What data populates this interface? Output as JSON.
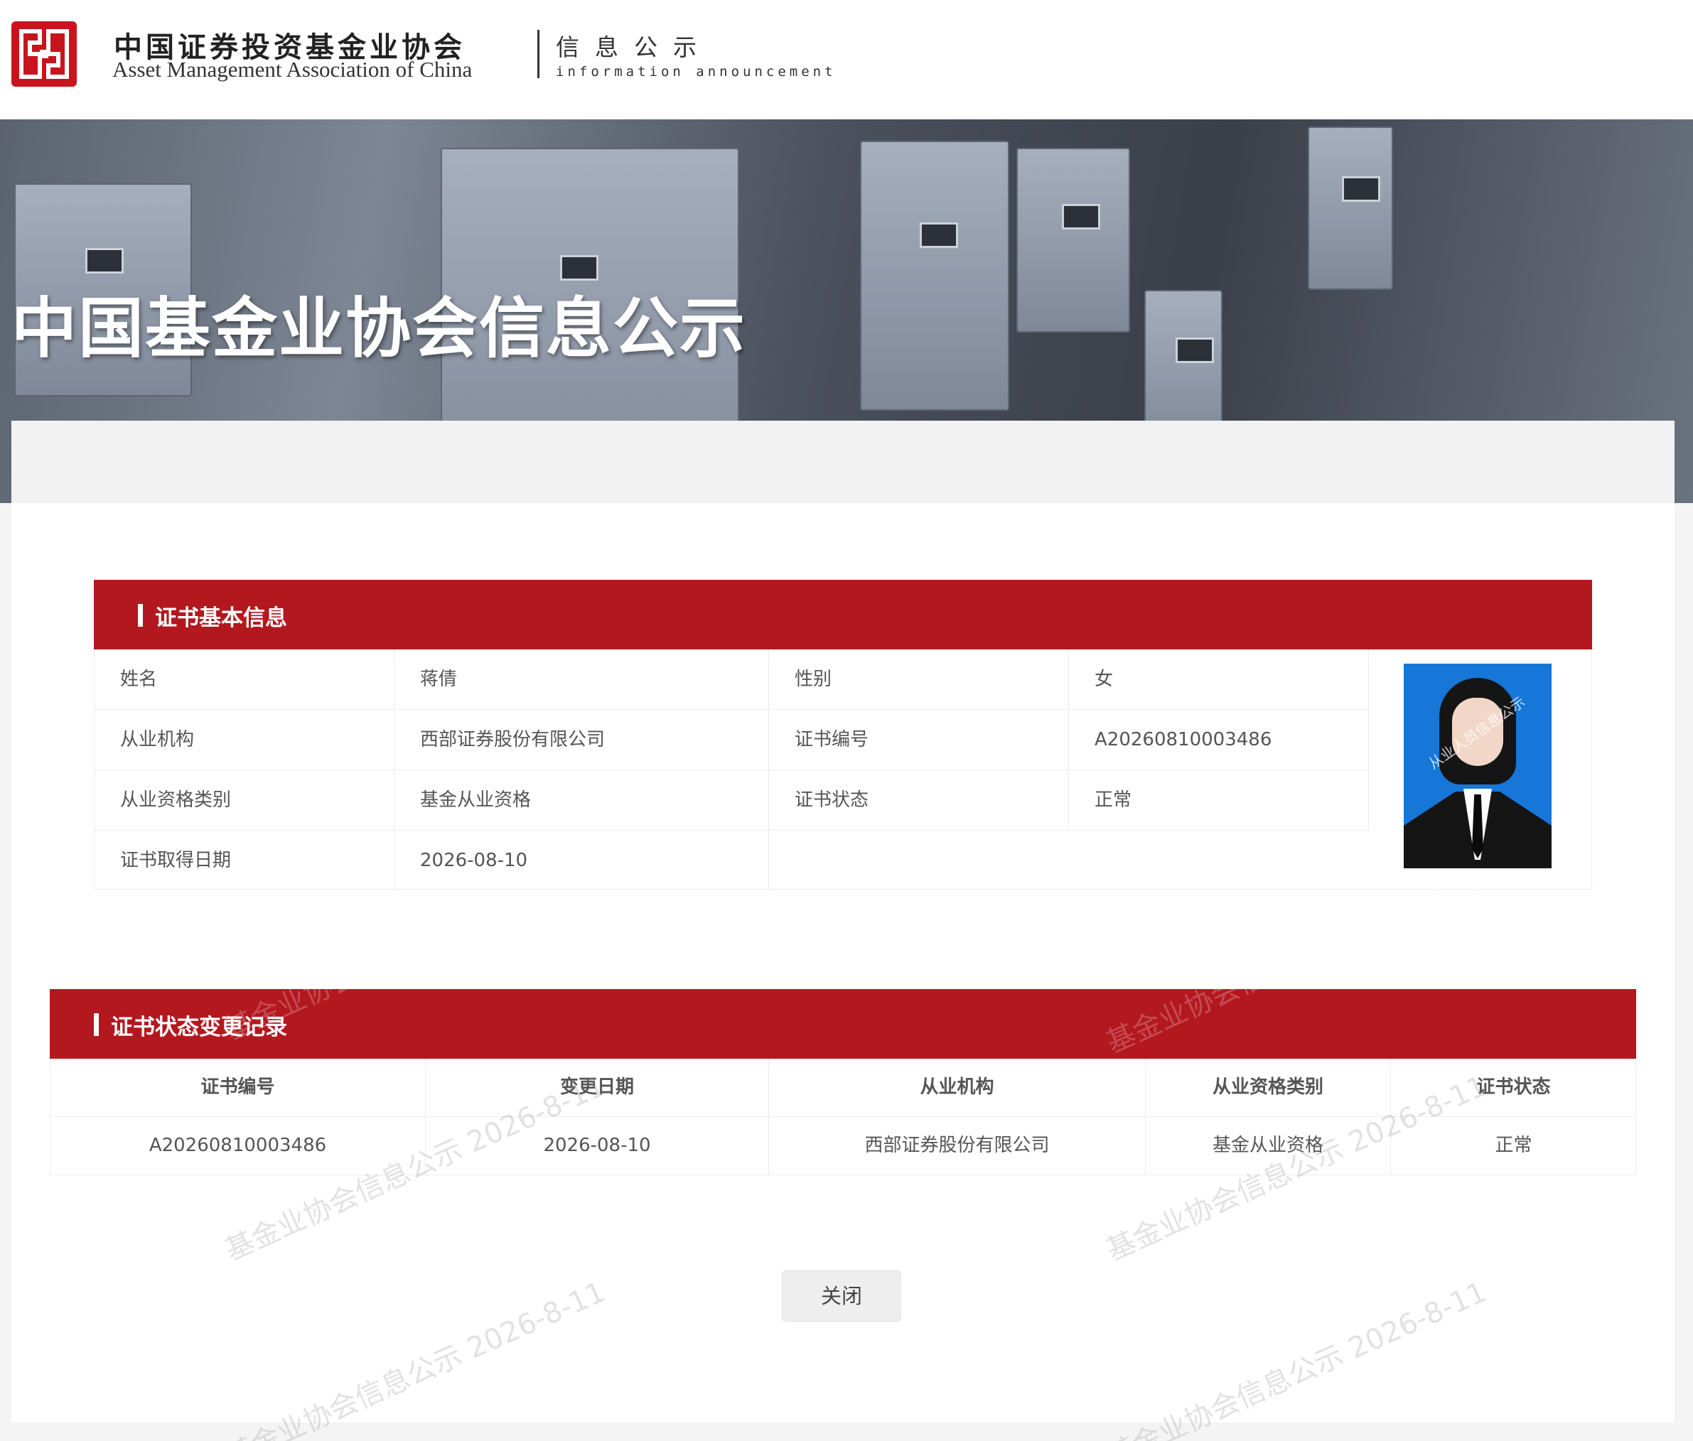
{
  "header": {
    "org_name_cn": "中国证券投资基金业协会",
    "org_name_en": "Asset Management Association of China",
    "section_cn": "信息公示",
    "section_en": "information announcement"
  },
  "banner": {
    "title": "中国基金业协会信息公示"
  },
  "basic_info": {
    "section_title": "证书基本信息",
    "fields": [
      {
        "label": "姓名",
        "value": "蒋倩"
      },
      {
        "label": "性别",
        "value": "女"
      },
      {
        "label": "从业机构",
        "value": "西部证券股份有限公司"
      },
      {
        "label": "证书编号",
        "value": "A20260810003486"
      },
      {
        "label": "从业资格类别",
        "value": "基金从业资格"
      },
      {
        "label": "证书状态",
        "value": "正常"
      },
      {
        "label": "证书取得日期",
        "value": "2026-08-10"
      }
    ],
    "photo_watermark": "从业人员信息公示"
  },
  "status_records": {
    "section_title": "证书状态变更记录",
    "columns": [
      "证书编号",
      "变更日期",
      "从业机构",
      "从业资格类别",
      "证书状态"
    ],
    "rows": [
      [
        "A20260810003486",
        "2026-08-10",
        "西部证券股份有限公司",
        "基金从业资格",
        "正常"
      ]
    ]
  },
  "actions": {
    "close_label": "关闭"
  },
  "watermark_text": "基金业协会信息公示 2026-8-11",
  "colors": {
    "brand_red": "#b4181f",
    "logo_red": "#c8141c",
    "photo_bg": "#1677d9"
  }
}
